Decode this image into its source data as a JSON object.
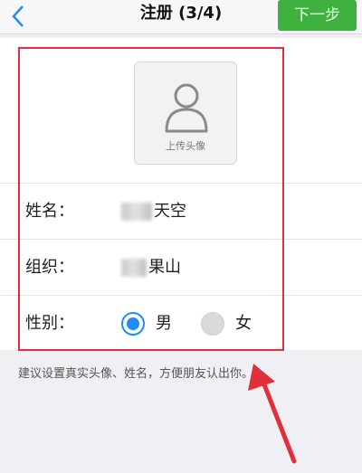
{
  "nav": {
    "title": "注册 (3/4)",
    "next_label": "下一步",
    "accent": "#3fb13f"
  },
  "avatar": {
    "label": "上传头像",
    "icon": "person-icon"
  },
  "form": {
    "name_label": "姓名：",
    "name_value": "天空",
    "org_label": "组织：",
    "org_value": "果山",
    "gender_label": "性别：",
    "gender_options": [
      "男",
      "女"
    ],
    "gender_selected": "男",
    "radio_color": "#1e8ef4"
  },
  "hint": "建议设置真实头像、姓名，方便朋友认出你。",
  "annotation_color": "#e0303a"
}
